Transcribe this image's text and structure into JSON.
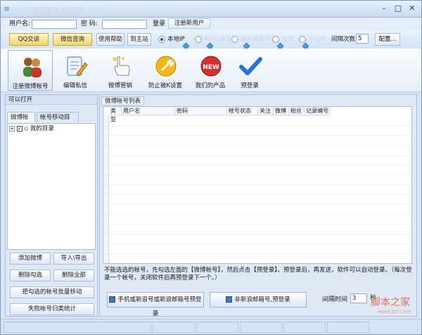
{
  "window": {
    "title": "**** 微博帐号注册软件 ****"
  },
  "login": {
    "username_label": "用户名:",
    "password_label": "密  码:",
    "login_btn": "登录",
    "register_btn": "注册新用户"
  },
  "ribbon": {
    "qq_btn": "QQ交谈",
    "wx_btn": "微信咨询",
    "help_btn": "使用帮助",
    "site_btn": "到主站",
    "modes": [
      "本地IP",
      "ADSL拨号",
      "路由器拨号",
      "代理",
      "手动IP"
    ],
    "interval_label": "间隔次数",
    "interval_value": "5",
    "config_btn": "配置..."
  },
  "tools": [
    {
      "label": "注册微博帐号",
      "icon": "people-icon"
    },
    {
      "label": "编辑私信",
      "icon": "edit-note-icon"
    },
    {
      "label": "微博营销",
      "icon": "hand-pointer-icon"
    },
    {
      "label": "防止被K设置",
      "icon": "wrench-icon"
    },
    {
      "label": "我们的产品",
      "icon": "new-badge-icon"
    },
    {
      "label": "预登录",
      "icon": "checkmark-icon"
    }
  ],
  "left": {
    "header": "可以打开",
    "tabs": [
      "微博帐号",
      "帐号移动目标"
    ],
    "tree_root": "我的目录",
    "buttons": {
      "add": "添加微博",
      "import_export": "导入\\导出",
      "delete_checked": "删除勾选",
      "delete_all": "删除全部",
      "batch_move": "把勾选的帐号批量移动",
      "failed_stats": "失败帐号归类统计"
    }
  },
  "right": {
    "tab": "微博帐号列表",
    "columns": [
      "类型",
      "用户名",
      "密码",
      "帐号状态",
      "关注",
      "微博",
      "粉丝",
      "记录编号"
    ],
    "note": "不能选选的帐号，先勾选左面的【微博帐号】，然后点击【预登录】。预登录后，再发送，软件可以自动登录。（每次登录一个帐号，关闭软件后再预登录下一个。）",
    "btn_register_phone": "手机或新浪号或新浪邮箱号预登录",
    "btn_register_email": "非新浪邮箱号,预登录",
    "interval_label": "间隔时间",
    "interval_value": "3",
    "interval_unit": "秒"
  },
  "watermark": {
    "text": "脚本之家",
    "url": "www.jb51.net"
  }
}
